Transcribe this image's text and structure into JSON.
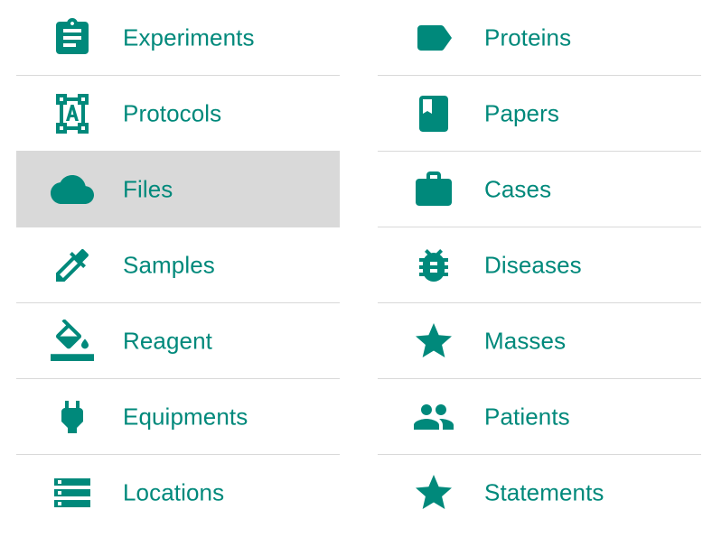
{
  "accent_color": "#00897b",
  "selected_background": "#d9d9d9",
  "left_menu": [
    {
      "label": "Experiments",
      "icon": "clipboard-icon",
      "selected": false
    },
    {
      "label": "Protocols",
      "icon": "text-frame-icon",
      "selected": false
    },
    {
      "label": "Files",
      "icon": "cloud-icon",
      "selected": true
    },
    {
      "label": "Samples",
      "icon": "dropper-icon",
      "selected": false
    },
    {
      "label": "Reagent",
      "icon": "paint-bucket-icon",
      "selected": false
    },
    {
      "label": "Equipments",
      "icon": "power-plug-icon",
      "selected": false
    },
    {
      "label": "Locations",
      "icon": "storage-rack-icon",
      "selected": false
    }
  ],
  "right_menu": [
    {
      "label": "Proteins",
      "icon": "label-tag-icon",
      "selected": false
    },
    {
      "label": "Papers",
      "icon": "bookmark-book-icon",
      "selected": false
    },
    {
      "label": "Cases",
      "icon": "briefcase-icon",
      "selected": false
    },
    {
      "label": "Diseases",
      "icon": "bug-icon",
      "selected": false
    },
    {
      "label": "Masses",
      "icon": "star-icon",
      "selected": false
    },
    {
      "label": "Patients",
      "icon": "people-icon",
      "selected": false
    },
    {
      "label": "Statements",
      "icon": "star-icon",
      "selected": false
    }
  ]
}
